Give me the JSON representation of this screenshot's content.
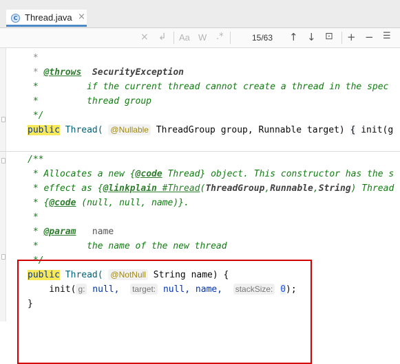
{
  "tab": {
    "file_icon_letter": "C",
    "title": "Thread.java",
    "close": "×"
  },
  "find": {
    "clear": "×",
    "history": "↲",
    "match_case": "Aa",
    "words": "W",
    "regex": ".*",
    "count": "15/63",
    "prev": "↑",
    "next": "↓",
    "in_selection": "⊡",
    "add_occurrence": "+",
    "remove_occurrence": "−",
    "select_all": "☰"
  },
  "code": {
    "l1": {
      "star": " * "
    },
    "l2": {
      "star": " * ",
      "tag": "@throws",
      "rest": "  SecurityException"
    },
    "l3": {
      "text": " *         if the current thread cannot create a thread in the spec"
    },
    "l4": {
      "text": " *         thread group"
    },
    "l5": {
      "text": " */"
    },
    "l6": {
      "kw": "public",
      "name": " Thread(",
      "ann": "@Nullable",
      "rest": " ThreadGroup group, Runnable target) ",
      "brace": "{",
      "tail": " init(g"
    },
    "l7": {
      "text": "/**"
    },
    "l8": {
      "p1": " * Allocates a new ",
      "p2": "{",
      "tag": "@code",
      "p3": " Thread} object. This constructor has the s"
    },
    "l9": {
      "p1": " * effect as ",
      "p2": "{",
      "tag": "@linkplain",
      "ref": " #Thread",
      "p3": "(",
      "b1": "ThreadGroup",
      "p4": ",",
      "b2": "Runnable",
      "p5": ",",
      "b3": "String",
      "p6": ") Thread"
    },
    "l10": {
      "p1": " * ",
      "p2": "{",
      "tag": "@code",
      "p3": " (null, null, name)}."
    },
    "l11": {
      "text": " *"
    },
    "l12": {
      "p1": " * ",
      "tag": "@param",
      "rest": "   name"
    },
    "l13": {
      "text": " *         the name of the new thread"
    },
    "l14": {
      "text": " */"
    },
    "l15": {
      "kw": "public",
      "name": " Thread(",
      "ann": "@NotNull",
      "rest": " String name) {"
    },
    "l16": {
      "indent": "    init(",
      "h1": "g:",
      "v1": " null,",
      "h2": "target:",
      "v2": " null, name, ",
      "h3": "stackSize:",
      "v3": "0",
      "end": ");"
    },
    "l17": {
      "text": "}"
    }
  }
}
